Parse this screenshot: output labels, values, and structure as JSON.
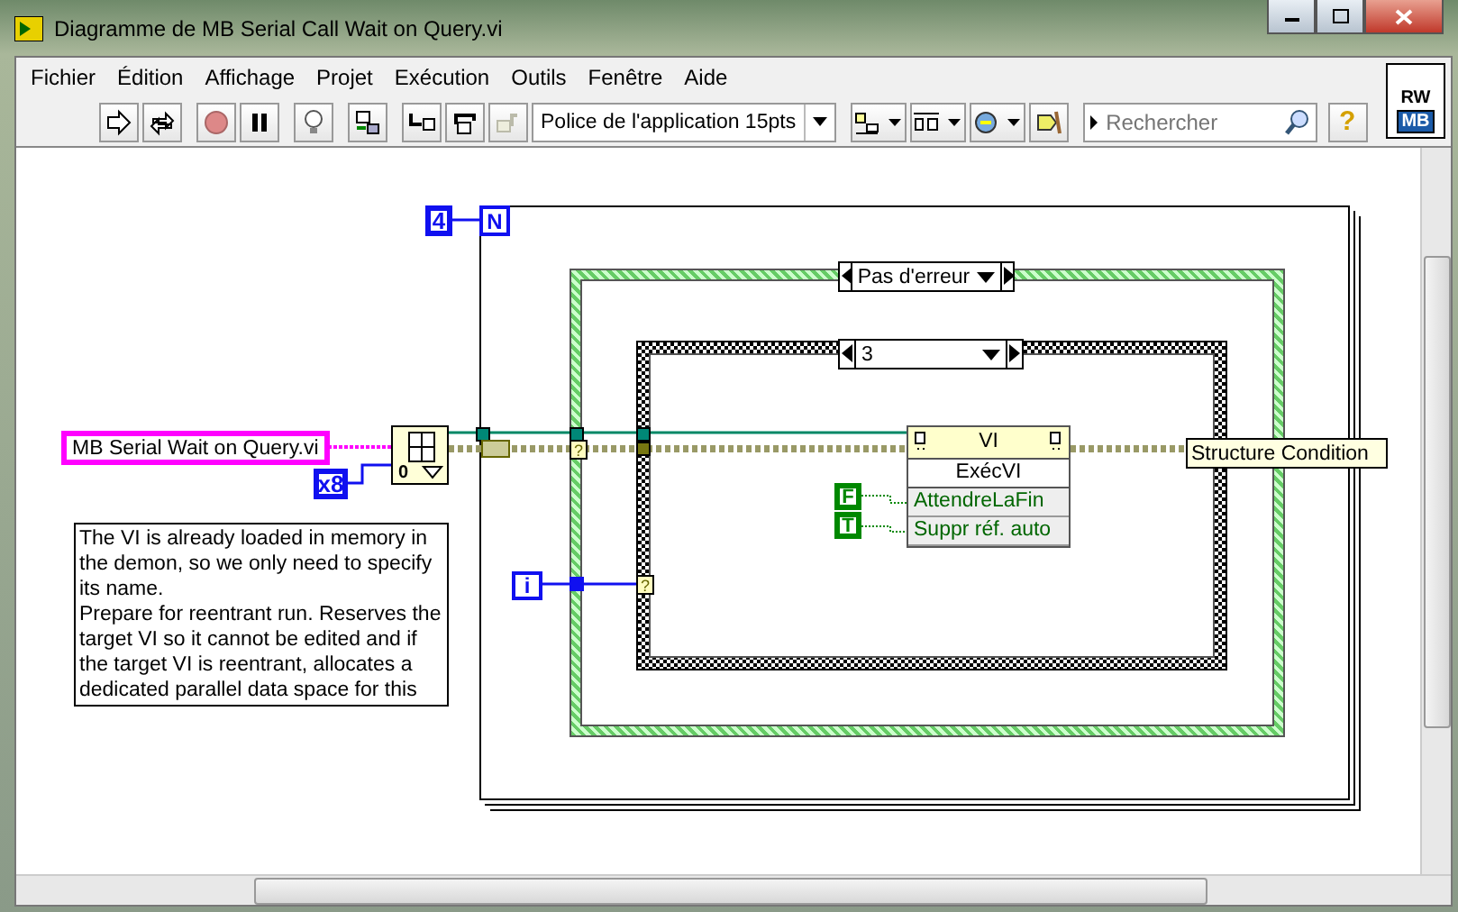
{
  "window": {
    "title": "Diagramme de MB Serial Call Wait on Query.vi"
  },
  "menu": [
    {
      "label": "Fichier"
    },
    {
      "label": "Édition"
    },
    {
      "label": "Affichage"
    },
    {
      "label": "Projet"
    },
    {
      "label": "Exécution"
    },
    {
      "label": "Outils"
    },
    {
      "label": "Fenêtre"
    },
    {
      "label": "Aide"
    }
  ],
  "toolbar": {
    "font": "Police de l'application 15pts",
    "help": "?"
  },
  "search": {
    "placeholder": "Rechercher"
  },
  "vi_icon": {
    "lines": [
      "RW",
      "MB"
    ]
  },
  "diagram": {
    "loop": {
      "count": "4",
      "count_terminal": "N",
      "iteration_terminal": "i"
    },
    "outer_case": {
      "selector": "Pas d'erreur"
    },
    "inner_case": {
      "selector": "3"
    },
    "path_constant": "MB Serial Wait on Query.vi",
    "options_constant": "x8",
    "open_ref_node": {
      "badge": "0"
    },
    "tunnels": [
      "?",
      "?"
    ],
    "invoke_node": {
      "class": "VI",
      "method": "ExécVI",
      "params": [
        {
          "name": "AttendreLaFin",
          "value": "F"
        },
        {
          "name": "Suppr réf. auto",
          "value": "T"
        }
      ]
    },
    "tooltip": "Structure Condition",
    "comment": "The VI is already loaded in memory in the demon, so we only need to specify its name.\nPrepare for reentrant run. Reserves the target VI so it cannot be edited and if the target VI is reentrant, allocates a dedicated parallel data space for this"
  }
}
